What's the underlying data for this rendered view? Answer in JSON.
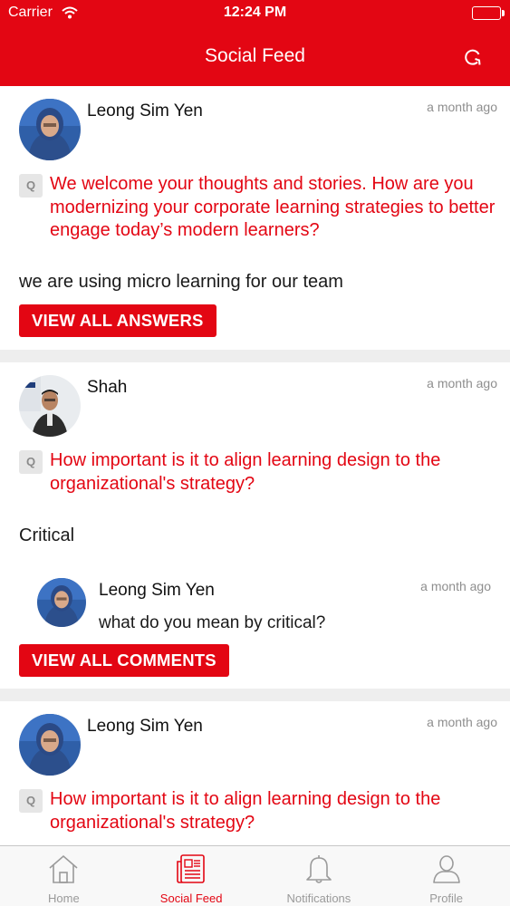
{
  "status_bar": {
    "carrier": "Carrier",
    "time": "12:24 PM"
  },
  "nav": {
    "title": "Social Feed",
    "refresh_icon": "refresh-icon"
  },
  "colors": {
    "brand": "#e30613",
    "separator": "#eeeeee",
    "muted": "#8e8e8e"
  },
  "feed": {
    "posts": [
      {
        "author": "Leong Sim Yen",
        "time": "a month ago",
        "q_badge": "Q",
        "question": "We welcome your thoughts and stories. How are you modernizing your corporate learning strategies to better engage today’s modern learners?",
        "answer": "we are using micro learning for our team",
        "button": "VIEW ALL ANSWERS"
      },
      {
        "author": "Shah",
        "time": "a month ago",
        "q_badge": "Q",
        "question": "How important is it to align learning design to the organizational's strategy?",
        "answer": "Critical",
        "comment": {
          "author": "Leong Sim Yen",
          "time": "a month ago",
          "text": "what do you mean by critical?"
        },
        "button": "VIEW ALL COMMENTS"
      },
      {
        "author": "Leong Sim Yen",
        "time": "a month ago",
        "q_badge": "Q",
        "question": "How important is it to align learning design to the organizational's strategy?"
      }
    ]
  },
  "tabs": [
    {
      "label": "Home",
      "icon": "home-icon",
      "active": false
    },
    {
      "label": "Social Feed",
      "icon": "newspaper-icon",
      "active": true
    },
    {
      "label": "Notifications",
      "icon": "bell-icon",
      "active": false
    },
    {
      "label": "Profile",
      "icon": "person-icon",
      "active": false
    }
  ]
}
